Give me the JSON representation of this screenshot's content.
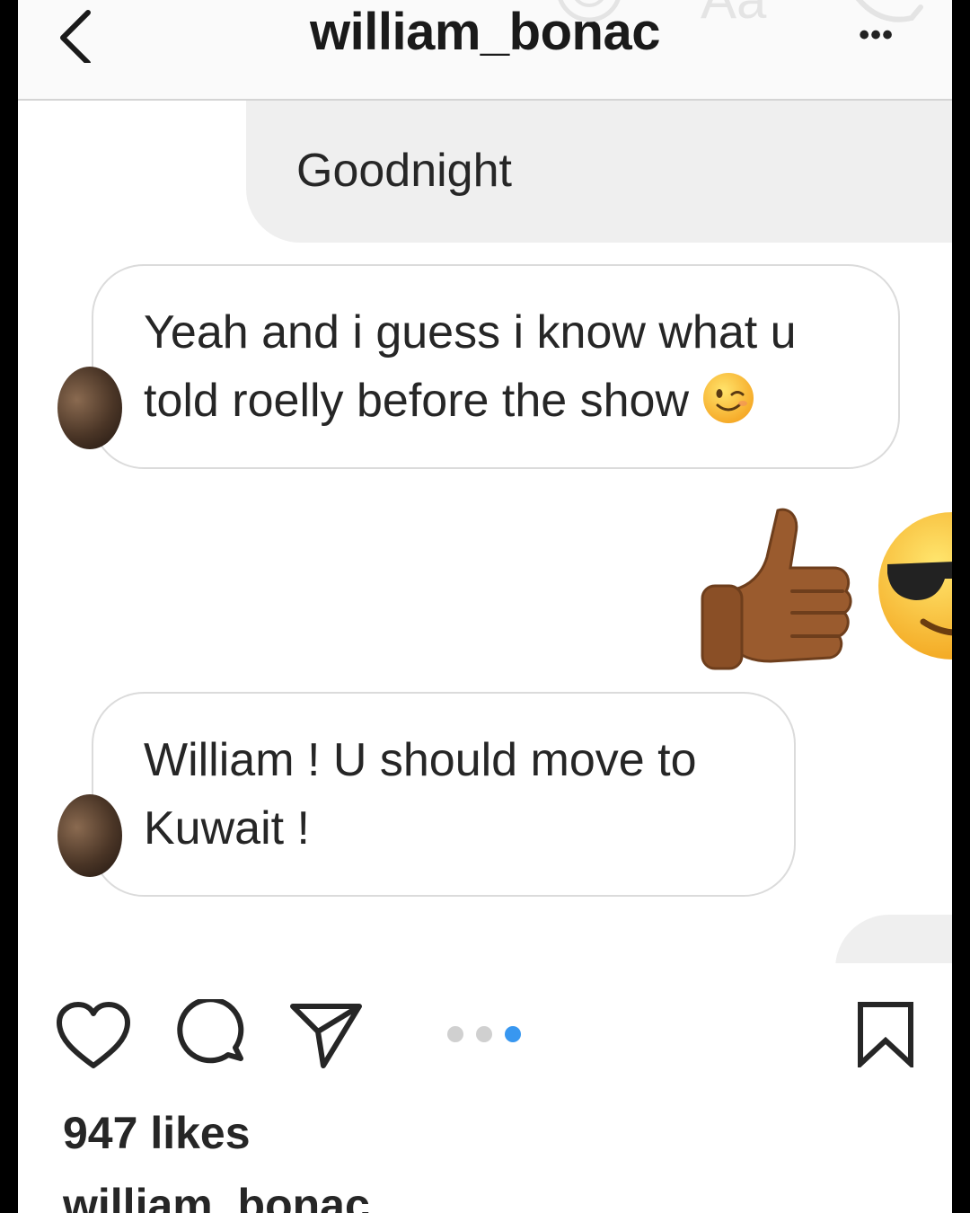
{
  "dm_header": {
    "username": "william_bonac",
    "more_label": "•••"
  },
  "messages": [
    {
      "direction": "sent",
      "text": "Goodnight"
    },
    {
      "direction": "received",
      "text": "Yeah and i guess i know what u\ntold roelly before the show",
      "trailing_emoji": "winking-face"
    },
    {
      "direction": "sent",
      "emojis": [
        "thumbs-up-medium-dark-skin",
        "smiling-face-with-sunglasses"
      ]
    },
    {
      "direction": "received",
      "text": "William ! U should move to\nKuwait  !"
    }
  ],
  "post": {
    "likes": "947 likes",
    "caption_username": "william_bonac",
    "carousel": {
      "total": 3,
      "active_index": 3
    }
  },
  "icons": {
    "back": "chevron-left-icon",
    "like": "heart-icon",
    "comment": "comment-bubble-icon",
    "share": "paper-plane-icon",
    "save": "bookmark-icon",
    "more": "ellipsis-icon"
  },
  "colors": {
    "sent_bubble": "#efefef",
    "received_bubble_border": "#dbdbdb",
    "carousel_active": "#3897f0",
    "carousel_inactive": "#d0d0d0",
    "text": "#262626"
  }
}
